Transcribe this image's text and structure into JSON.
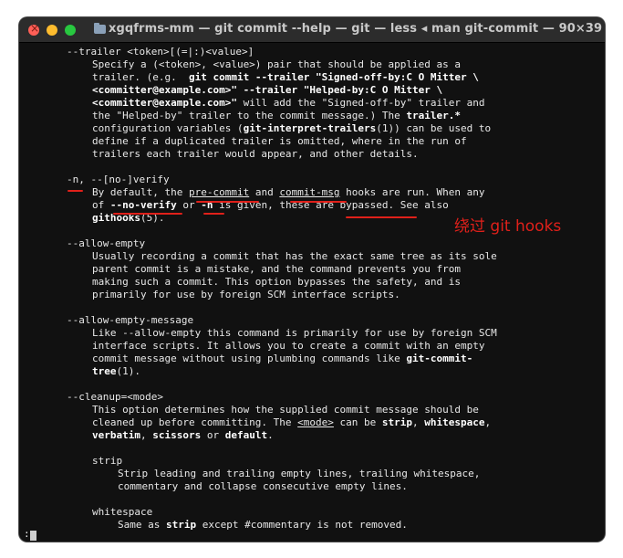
{
  "window": {
    "title": "xgqfrms-mm — git commit --help — git — less ◂ man git-commit — 90×39",
    "pager_prompt": ":"
  },
  "annotation": "绕过 git hooks",
  "accent_color": "#e0201a",
  "man_page": {
    "trailer": {
      "option": "--trailer <token>[(=|:)<value>]",
      "l1": "Specify a (<token>, <value>) pair that should be applied as a",
      "l2a": "trailer. (e.g.  ",
      "l2b": "git commit --trailer \"Signed-off-by:C O Mitter \\",
      "l3": "<committer@example.com>\" --trailer \"Helped-by:C O Mitter \\",
      "l4a": "<committer@example.com>\"",
      "l4b": " will add the \"Signed-off-by\" trailer and",
      "l5a": "the \"Helped-by\" trailer to the commit message.) The ",
      "l5b": "trailer.*",
      "l6a": "configuration variables (",
      "l6b": "git-interpret-trailers",
      "l6c": "(1)) can be used to",
      "l7": "define if a duplicated trailer is omitted, where in the run of",
      "l8": "trailers each trailer would appear, and other details."
    },
    "verify": {
      "option": "-n, --[no-]verify",
      "l1a": "By default, the ",
      "l1b": "pre-commit",
      "l1c": " and ",
      "l1d": "commit-msg",
      "l1e": " hooks are run. When any",
      "l2a": "of ",
      "l2b": "--no-verify",
      "l2c": " or ",
      "l2d": "-n",
      "l2e": " is given, these are bypassed. See also",
      "l3a": "githooks",
      "l3b": "(5)."
    },
    "allow_empty": {
      "option": "--allow-empty",
      "l1": "Usually recording a commit that has the exact same tree as its sole",
      "l2": "parent commit is a mistake, and the command prevents you from",
      "l3": "making such a commit. This option bypasses the safety, and is",
      "l4": "primarily for use by foreign SCM interface scripts."
    },
    "allow_empty_message": {
      "option": "--allow-empty-message",
      "l1": "Like --allow-empty this command is primarily for use by foreign SCM",
      "l2": "interface scripts. It allows you to create a commit with an empty",
      "l3a": "commit message without using plumbing commands like ",
      "l3b": "git-commit-",
      "l4a": "tree",
      "l4b": "(1)."
    },
    "cleanup": {
      "option": "--cleanup=<mode>",
      "l1": "This option determines how the supplied commit message should be",
      "l2a": "cleaned up before committing. The ",
      "l2b": "<mode>",
      "l2c": " can be ",
      "l2d": "strip",
      "l2e": ", ",
      "l2f": "whitespace",
      "l2g": ",",
      "l3a": "verbatim",
      "l3b": ", ",
      "l3c": "scissors",
      "l3d": " or ",
      "l3e": "default",
      "l3f": ".",
      "strip_heading": "strip",
      "strip_l1": "Strip leading and trailing empty lines, trailing whitespace,",
      "strip_l2": "commentary and collapse consecutive empty lines.",
      "ws_heading": "whitespace",
      "ws_l1a": "Same as ",
      "ws_l1b": "strip",
      "ws_l1c": " except #commentary is not removed."
    }
  }
}
